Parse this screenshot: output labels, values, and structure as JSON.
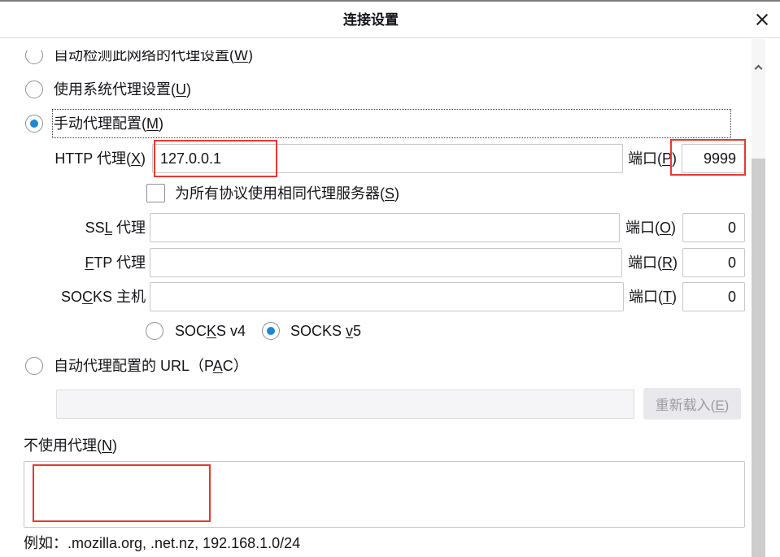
{
  "window": {
    "title": "连接设置"
  },
  "icons": {
    "close": "close-icon",
    "scroll_up": "chevron-up-icon"
  },
  "colors": {
    "accent": "#1f86d3",
    "annotation": "#e53935"
  },
  "proxy_mode": {
    "auto_detect": {
      "label": {
        "pre": "自动检测此网络的代理设置(",
        "key": "W",
        "post": ")"
      },
      "selected": false
    },
    "system": {
      "label": {
        "pre": "使用系统代理设置(",
        "key": "U",
        "post": ")"
      },
      "selected": false
    },
    "manual": {
      "label": {
        "pre": "手动代理配置(",
        "key": "M",
        "post": ")"
      },
      "selected": true
    },
    "pac": {
      "label": {
        "pre": "自动代理配置的 URL（P",
        "key": "A",
        "post": "C）"
      },
      "selected": false
    }
  },
  "manual": {
    "http": {
      "label": {
        "pre": "HTTP 代理(",
        "key": "X",
        "post": ")"
      },
      "value": "127.0.0.1",
      "port_label": {
        "pre": "端口(",
        "key": "P",
        "post": ")"
      },
      "port": "9999"
    },
    "share": {
      "label": {
        "pre": "为所有协议使用相同代理服务器(",
        "key": "S",
        "post": ")"
      },
      "checked": false
    },
    "ssl": {
      "label": {
        "pre": "SS",
        "key": "L",
        "post": " 代理"
      },
      "value": "",
      "port_label": {
        "pre": "端口(",
        "key": "O",
        "post": ")"
      },
      "port": "0"
    },
    "ftp": {
      "label": {
        "key": "F",
        "post": "TP 代理"
      },
      "value": "",
      "port_label": {
        "pre": "端口(",
        "key": "R",
        "post": ")"
      },
      "port": "0"
    },
    "socks": {
      "label": {
        "pre": "SO",
        "key": "C",
        "post": "KS 主机"
      },
      "value": "",
      "port_label": {
        "pre": "端口(",
        "key": "T",
        "post": ")"
      },
      "port": "0"
    },
    "socks_v4": {
      "label": {
        "pre": "SOC",
        "key": "K",
        "post": "S v4"
      },
      "selected": false
    },
    "socks_v5": {
      "label": {
        "pre": "SOCKS ",
        "key": "v",
        "post": "5"
      },
      "selected": true
    }
  },
  "pac": {
    "url": "",
    "reload_label": {
      "pre": "重新载入(",
      "key": "E",
      "post": ")"
    }
  },
  "no_proxy": {
    "label": {
      "pre": "不使用代理(",
      "key": "N",
      "post": ")"
    },
    "value": "",
    "example": "例如：.mozilla.org, .net.nz, 192.168.1.0/24"
  }
}
